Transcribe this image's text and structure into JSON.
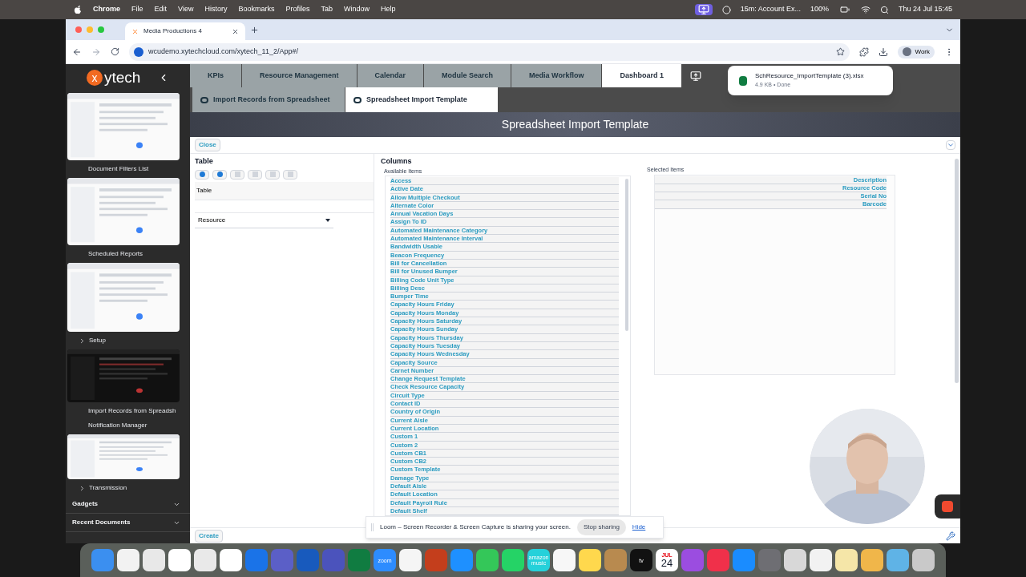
{
  "menu_bar": {
    "app": "Chrome",
    "items": [
      "File",
      "Edit",
      "View",
      "History",
      "Bookmarks",
      "Profiles",
      "Tab",
      "Window",
      "Help"
    ],
    "meeting": "15m: Account Ex...",
    "battery": "100%",
    "clock": "Thu 24 Jul 15:45"
  },
  "browser": {
    "tab_title": "Media Productions 4",
    "url": "wcudemo.xytechcloud.com/xytech_11_2/App#/",
    "profile": "Work"
  },
  "download": {
    "file": "SchResource_ImportTemplate (3).xlsx",
    "info": "4.9 KB • Done"
  },
  "sidebar": {
    "logo_mark": "x",
    "logo_text": "ytech",
    "items": [
      {
        "kind": "picture"
      },
      {
        "kind": "link",
        "label": "Document Filters List"
      },
      {
        "kind": "picture"
      },
      {
        "kind": "link",
        "label": "Scheduled Reports"
      },
      {
        "kind": "picture"
      },
      {
        "kind": "folder",
        "label": "Setup"
      },
      {
        "kind": "picture"
      },
      {
        "kind": "link",
        "label": "Import Records from Spreadsh"
      },
      {
        "kind": "link",
        "label": "Notification Manager"
      },
      {
        "kind": "picture"
      },
      {
        "kind": "folder",
        "label": "Transmission"
      },
      {
        "kind": "section",
        "label": "Gadgets"
      },
      {
        "kind": "section",
        "label": "Recent Documents"
      }
    ]
  },
  "nav_tabs": [
    {
      "label": "KPIs",
      "selected": false
    },
    {
      "label": "Resource Management",
      "selected": false
    },
    {
      "label": "Calendar",
      "selected": false
    },
    {
      "label": "Module Search",
      "selected": false
    },
    {
      "label": "Media Workflow",
      "selected": false
    },
    {
      "label": "Dashboard 1",
      "selected": true
    }
  ],
  "sub_tabs": [
    {
      "label": "Import Records from Spreadsheet",
      "selected": false
    },
    {
      "label": "Spreadsheet Import Template",
      "selected": true
    }
  ],
  "page_title": "Spreadsheet Import Template",
  "close_button": "Close",
  "table": {
    "heading": "Table",
    "column_header": "Table",
    "value": "Resource"
  },
  "columns": {
    "heading": "Columns",
    "available_label": "Available Items",
    "available": [
      "Access",
      "Active Date",
      "Allow Multiple Checkout",
      "Alternate Color",
      "Annual Vacation Days",
      "Assign To ID",
      "Automated Maintenance Category",
      "Automated Maintenance Interval",
      "Bandwidth Usable",
      "Beacon Frequency",
      "Bill for Cancellation",
      "Bill for Unused Bumper",
      "Billing Code Unit Type",
      "Billing Desc",
      "Bumper Time",
      "Capacity Hours Friday",
      "Capacity Hours Monday",
      "Capacity Hours Saturday",
      "Capacity Hours Sunday",
      "Capacity Hours Thursday",
      "Capacity Hours Tuesday",
      "Capacity Hours Wednesday",
      "Capacity Source",
      "Carnet Number",
      "Change Request Template",
      "Check Resource Capacity",
      "Circuit Type",
      "Contact ID",
      "Country of Origin",
      "Current Aisle",
      "Current Location",
      "Custom 1",
      "Custom 2",
      "Custom CB1",
      "Custom CB2",
      "Custom Template",
      "Damage Type",
      "Default Aisle",
      "Default Location",
      "Default Payroll Rule",
      "Default Shelf"
    ],
    "selected_label": "Selected Items",
    "selected": [
      "Description",
      "Resource Code",
      "Serial No",
      "Barcode"
    ]
  },
  "create_button": "Create",
  "loom": {
    "message": "Loom – Screen Recorder & Screen Capture is sharing your screen.",
    "stop": "Stop sharing",
    "hide": "Hide"
  },
  "dock": [
    {
      "color": "#3b8ff0"
    },
    {
      "color": "#f2f2f2"
    },
    {
      "color": "#e8e8e8"
    },
    {
      "color": "#ffffff"
    },
    {
      "color": "#e9e9e9"
    },
    {
      "color": "#ffffff"
    },
    {
      "color": "#1a73e8"
    },
    {
      "color": "#5b5fc7"
    },
    {
      "color": "#185abd"
    },
    {
      "color": "#4b53bc"
    },
    {
      "color": "#107c41"
    },
    {
      "color": "#2d8cff",
      "label": "zoom"
    },
    {
      "color": "#f5f5f5"
    },
    {
      "color": "#c43e1c"
    },
    {
      "color": "#1e90ff"
    },
    {
      "color": "#34c759"
    },
    {
      "color": "#25d366"
    },
    {
      "color": "#25d1da",
      "label": "amazon music"
    },
    {
      "color": "#f7f7f7"
    },
    {
      "color": "#ffd84d"
    },
    {
      "color": "#b88a4f"
    },
    {
      "color": "#111111",
      "label": "tv"
    },
    {
      "color": "#ffffff",
      "month": "JUL",
      "day": "24"
    },
    {
      "color": "#9b4de0"
    },
    {
      "color": "#f0304a"
    },
    {
      "color": "#1a8cff"
    },
    {
      "color": "#6e6e73"
    },
    {
      "color": "#d8d8d8"
    },
    {
      "color": "#f2f2f2"
    },
    {
      "color": "#f5e6a8"
    },
    {
      "color": "#f0b64a"
    },
    {
      "color": "#5fb3e6"
    },
    {
      "color": "#c9c9c9"
    }
  ]
}
